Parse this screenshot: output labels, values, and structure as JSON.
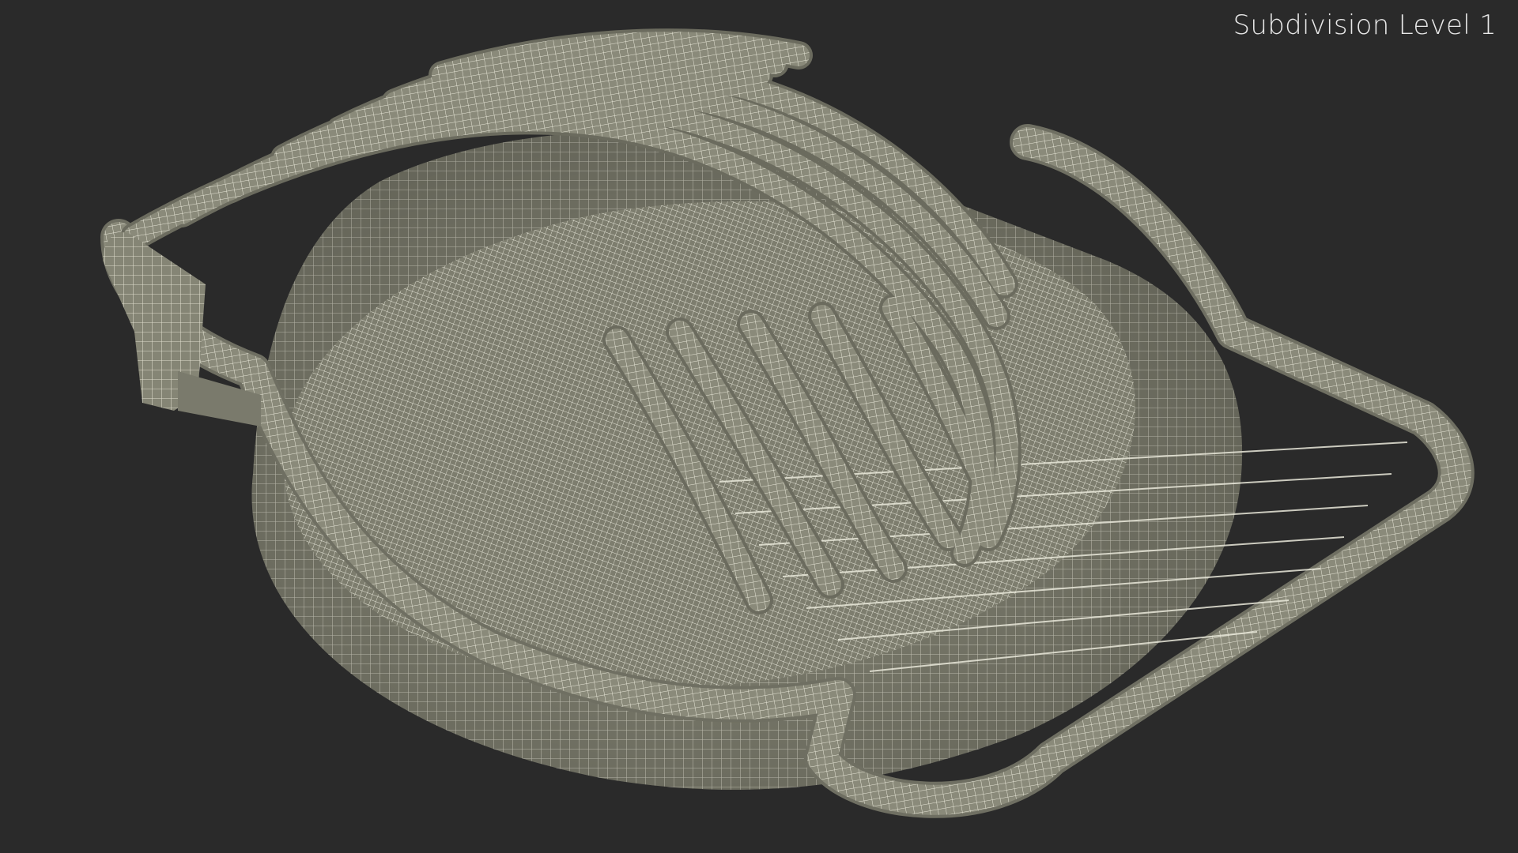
{
  "viewport": {
    "label": "Subdivision Level 1",
    "colors": {
      "background": "#2a2a2a",
      "surface": "#8c8c7c",
      "wire": "#f2f2e4"
    }
  }
}
